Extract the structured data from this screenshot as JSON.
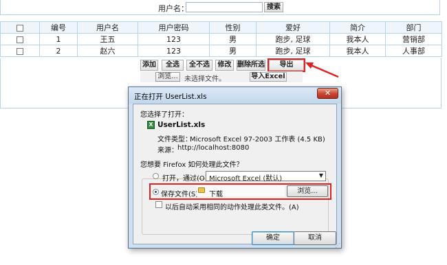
{
  "search": {
    "label": "用户名：",
    "value": "",
    "button": "搜索"
  },
  "table": {
    "headers": [
      "",
      "编号",
      "用户名",
      "用户密码",
      "性别",
      "爱好",
      "简介",
      "部门"
    ],
    "rows": [
      [
        "",
        "1",
        "王五",
        "123",
        "男",
        "跑步, 足球",
        "我本人",
        "营销部"
      ],
      [
        "",
        "2",
        "赵六",
        "123",
        "男",
        "跑步, 足球",
        "我本人",
        "人事部"
      ]
    ]
  },
  "actions": {
    "add": "添加",
    "select_all": "全选",
    "select_none": "全不选",
    "edit": "修改",
    "delete_selected": "删除所选",
    "export": "导出Excel"
  },
  "upload": {
    "browse": "浏览...",
    "no_file": "未选择文件。",
    "import": "导入Excel"
  },
  "dialog": {
    "title": "正在打开 UserList.xls",
    "close": "✕",
    "intro": "您选择了打开：",
    "file_name": "UserList.xls",
    "file_type_label": "文件类型：",
    "file_type": "Microsoft Excel 97-2003 工作表 (4.5 KB)",
    "source_label": "来源：",
    "source": "http://localhost:8080",
    "question": "您想要 Firefox 如何处理此文件？",
    "open_label": "打开，通过(O)",
    "open_app": "Microsoft Excel (默认)",
    "save_label": "保存文件(S)",
    "save_folder": "下载",
    "browse": "浏览...",
    "auto_label": "以后自动采用相同的动作处理此类文件。(A)",
    "ok": "确定",
    "cancel": "取消",
    "selected_option": "save"
  },
  "colors": {
    "highlight": "#e02020",
    "table_border": "#b7d3ea"
  }
}
